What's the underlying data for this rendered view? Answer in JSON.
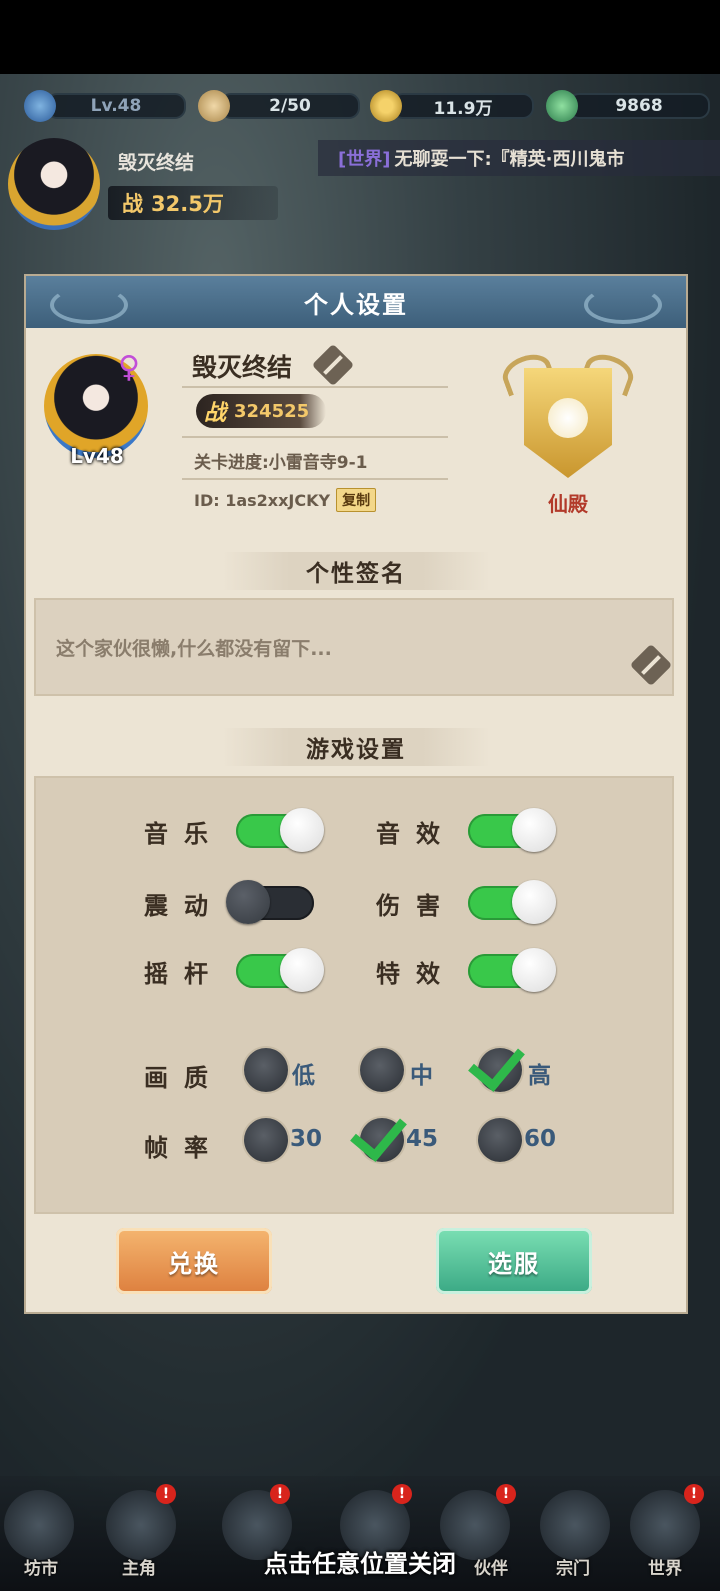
{
  "top": {
    "level": "Lv.48",
    "stamina": "2/50",
    "coins": "11.9万",
    "jade": "9868"
  },
  "header": {
    "player_name": "毁灭终结",
    "power_prefix": "战",
    "power": "32.5万",
    "ticker_channel": "[世界]",
    "ticker_text": "无聊耍一下:『精英·西川鬼市"
  },
  "dialog": {
    "title": "个人设置",
    "level": "Lv48",
    "gender_symbol": "♀",
    "name": "毁灭终结",
    "power_prefix": "战",
    "power": "324525",
    "progress": "关卡进度:小雷音寺9-1",
    "id_text": "ID: 1as2xxJCKY",
    "copy_label": "复制",
    "badge_label": "仙殿",
    "signature_header": "个性签名",
    "signature_text": "这个家伙很懒,什么都没有留下...",
    "settings_header": "游戏设置",
    "toggles": {
      "music": {
        "label": "音乐",
        "on": true
      },
      "sfx": {
        "label": "音效",
        "on": true
      },
      "vibration": {
        "label": "震动",
        "on": false
      },
      "damage": {
        "label": "伤害",
        "on": true
      },
      "joystick": {
        "label": "摇杆",
        "on": true
      },
      "effects": {
        "label": "特效",
        "on": true
      }
    },
    "quality": {
      "label": "画质",
      "options": [
        "低",
        "中",
        "高"
      ],
      "selected": "高"
    },
    "framerate": {
      "label": "帧率",
      "options": [
        "30",
        "45",
        "60"
      ],
      "selected": "45"
    },
    "redeem_button": "兑换",
    "server_button": "选服"
  },
  "nav": {
    "items": [
      "坊市",
      "主角",
      "伙伴",
      "宗门",
      "世界"
    ],
    "close_hint": "点击任意位置关闭"
  },
  "colors": {
    "toggle_on": "#39c84a",
    "toggle_off": "#2a2e34",
    "accent_title": "#3d5f7a"
  }
}
